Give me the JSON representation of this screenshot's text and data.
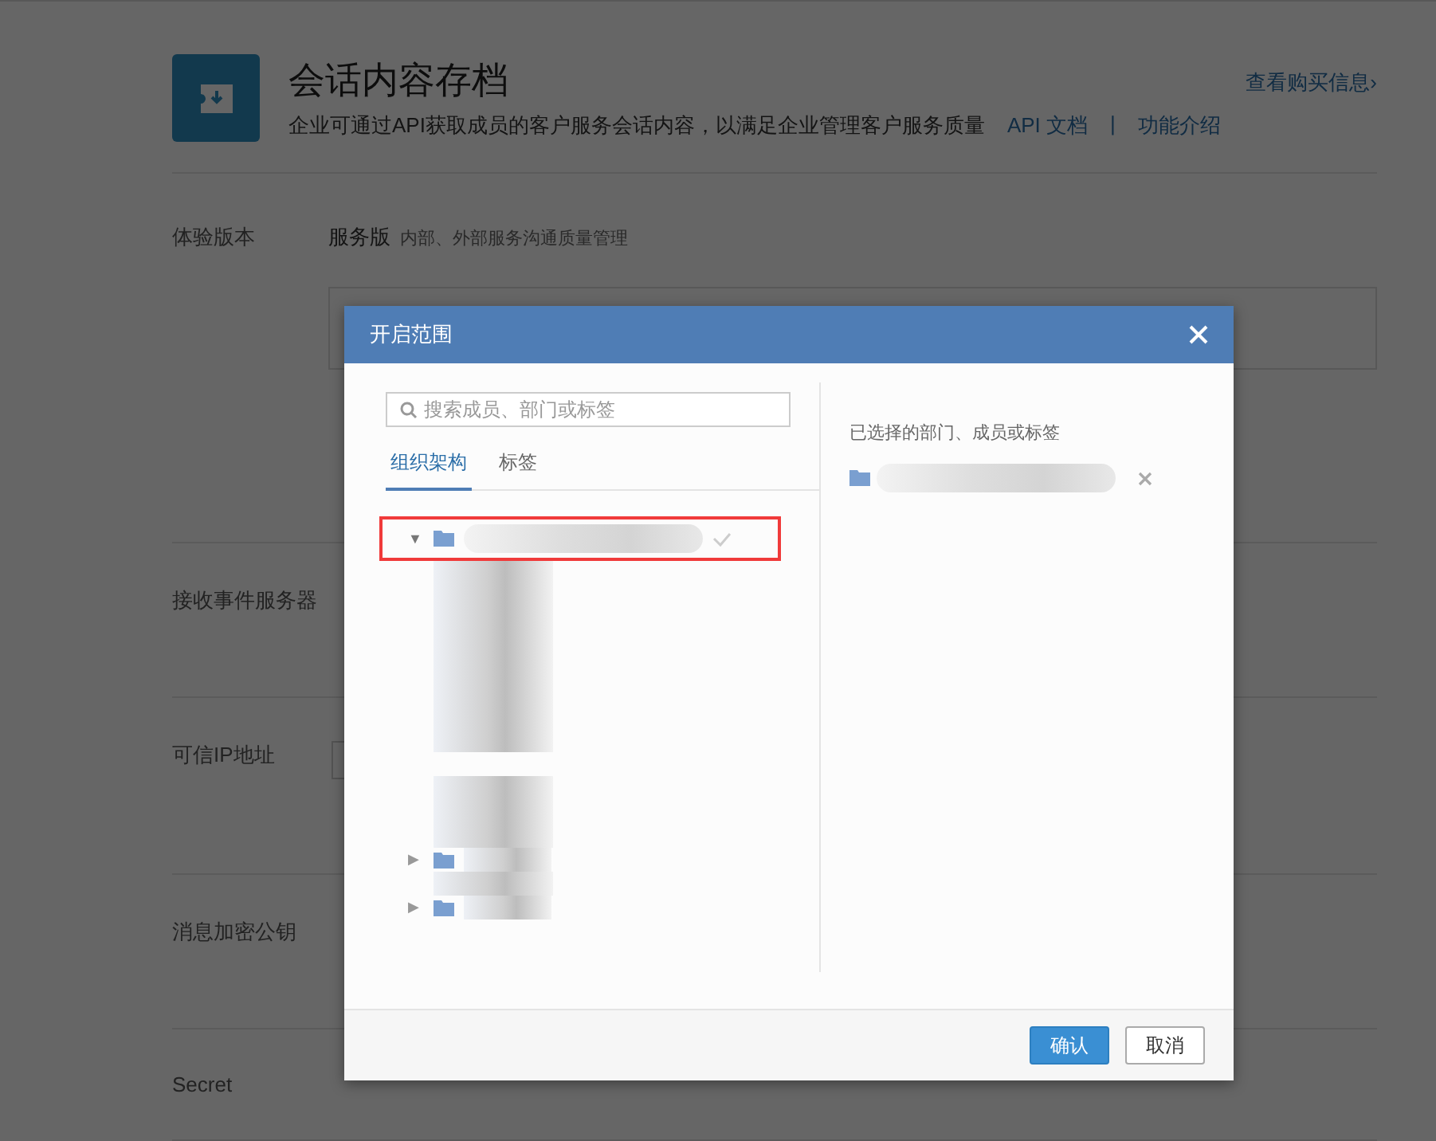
{
  "page": {
    "title": "会话内容存档",
    "description": "企业可通过API获取成员的客户服务会话内容，以满足企业管理客户服务质量",
    "links": [
      {
        "label": "API 文档"
      },
      {
        "label": "功能介绍"
      }
    ],
    "separator": "|",
    "purchase_link": "查看购买信息›"
  },
  "sections": [
    {
      "kind": "edition",
      "label": "体验版本",
      "value": "服务版",
      "note": "内部、外部服务沟通质量管理"
    },
    {
      "kind": "text",
      "label": "接收事件服务器"
    },
    {
      "kind": "input",
      "label": "可信IP地址"
    },
    {
      "kind": "text",
      "label": "消息加密公钥"
    },
    {
      "kind": "text",
      "label": "Secret"
    }
  ],
  "dialog": {
    "title": "开启范围",
    "search": {
      "placeholder": "搜索成员、部门或标签"
    },
    "tabs": [
      {
        "label": "组织架构",
        "selected": true
      },
      {
        "label": "标签",
        "selected": false
      }
    ],
    "tree": [
      {
        "kind": "folder",
        "toggle": "▼",
        "expanded": true,
        "checked": true,
        "highlighted": true,
        "children": [
          {
            "kind": "member"
          },
          {
            "kind": "member"
          },
          {
            "kind": "member"
          },
          {
            "kind": "member"
          },
          {
            "kind": "member"
          },
          {
            "kind": "member"
          },
          {
            "kind": "member"
          },
          {
            "kind": "member"
          },
          {
            "kind": "gap"
          },
          {
            "kind": "member"
          },
          {
            "kind": "member"
          },
          {
            "kind": "member"
          },
          {
            "kind": "folder",
            "toggle": "▶",
            "expanded": false
          },
          {
            "kind": "member"
          },
          {
            "kind": "folder",
            "toggle": "▶",
            "expanded": false
          }
        ]
      }
    ],
    "selected_heading": "已选择的部门、成员或标签",
    "selected_items": [
      {
        "kind": "folder"
      }
    ],
    "buttons": [
      {
        "label": "确认",
        "kind": "primary"
      },
      {
        "label": "取消",
        "kind": "secondary"
      }
    ]
  }
}
